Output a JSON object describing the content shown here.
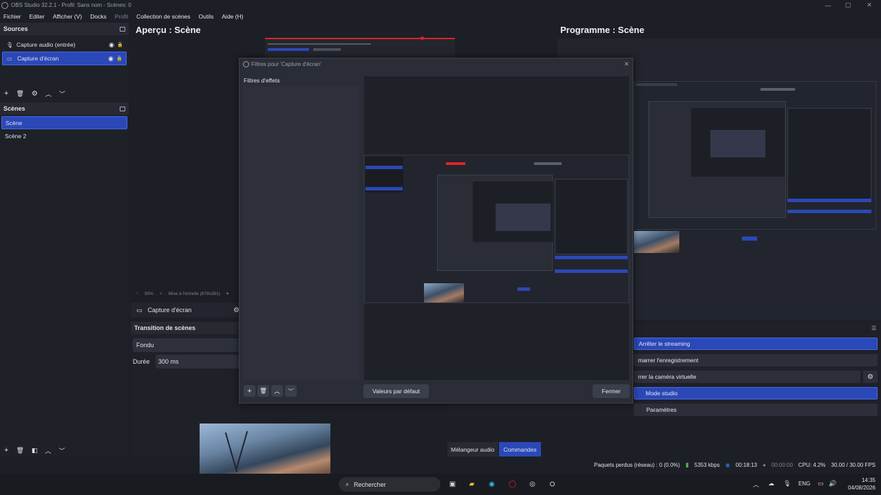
{
  "window": {
    "title": "OBS Studio 32.2.1 - Profil: Sans nom - Scènes: 0",
    "controls": [
      "—",
      "▢",
      "✕"
    ]
  },
  "menu": [
    "Fichier",
    "Editer",
    "Afficher (V)",
    "Docks",
    "Profil",
    "Collection de scènes",
    "Outils",
    "Aide (H)"
  ],
  "sources": {
    "title": "Sources",
    "items": [
      {
        "label": "Capture audio (entrée)",
        "icon": "microphone-icon"
      },
      {
        "label": "Capture d'écran",
        "icon": "monitor-icon"
      }
    ]
  },
  "scenes": {
    "title": "Scènes",
    "items": [
      "Scène",
      "Scène 2"
    ]
  },
  "preview": {
    "label": "Aperçu : Scène",
    "zoom": "35%",
    "scale_mode": "Mise à l'échelle (678x381)"
  },
  "program": {
    "label": "Programme : Scène"
  },
  "source_bar": {
    "label": "Capture d'écran"
  },
  "transitions": {
    "title": "Transition de scènes",
    "type": "Fondu",
    "duration_label": "Durée",
    "duration_value": "300 ms"
  },
  "filter_dialog": {
    "title": "Filtres pour 'Capture d'écran'",
    "effects_label": "Filtres d'effets",
    "defaults_button": "Valeurs par défaut",
    "close_button": "Fermer"
  },
  "controls": {
    "stop_streaming": "Arrêter le streaming",
    "start_recording": "marrer l'enregistrement",
    "start_virtual_cam": "rrer la caméra virtuelle",
    "studio_mode": "Mode studio",
    "settings": "Paramètres"
  },
  "dock_tabs": {
    "audio_mixer": "Mélangeur audio",
    "controls": "Commandes"
  },
  "status": {
    "dropped_frames": "Paquets perdus (réseau) : 0 (0.0%)",
    "bitrate": "5353 kbps",
    "stream_time": "00:18:13",
    "rec_time": "00:00:00",
    "cpu": "CPU: 4.2%",
    "fps": "30.00 / 30.00 FPS"
  },
  "taskbar": {
    "search_placeholder": "Rechercher",
    "language": "ENG",
    "time": "14:35",
    "date": "04/08/2026"
  },
  "colors": {
    "accent": "#2b48b8",
    "background": "#1d1f26",
    "panel": "#272a33",
    "record_red": "#e0222a",
    "live_green": "#4caf50"
  }
}
